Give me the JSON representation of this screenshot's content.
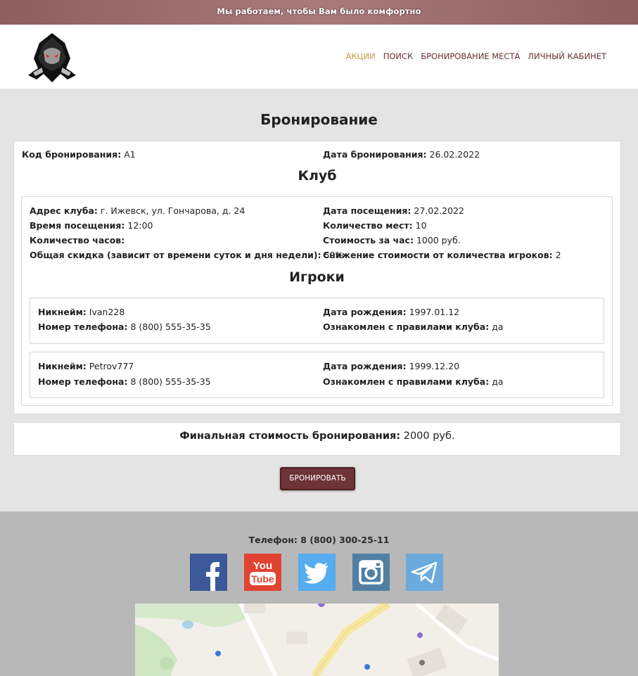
{
  "topbar": {
    "text": "Мы работаем, чтобы Вам было комфортно"
  },
  "nav": {
    "items": [
      {
        "label": "АКЦИИ",
        "active": true
      },
      {
        "label": "ПОИСК",
        "active": false
      },
      {
        "label": "БРОНИРОВАНИЕ МЕСТА",
        "active": false
      },
      {
        "label": "ЛИЧНЫЙ КАБИНЕТ",
        "active": false
      }
    ]
  },
  "page": {
    "title": "Бронирование"
  },
  "booking": {
    "code_label": "Код бронирования:",
    "code": "A1",
    "date_label": "Дата бронирования:",
    "date": "26.02.2022"
  },
  "club": {
    "title": "Клуб",
    "address_label": "Адрес клуба:",
    "address": "г. Ижевск, ул. Гончарова, д. 24",
    "visit_date_label": "Дата посещения:",
    "visit_date": "27.02.2022",
    "visit_time_label": "Время посещения:",
    "visit_time": "12:00",
    "seats_label": "Количество мест:",
    "seats": "10",
    "hours_label": "Количество часов:",
    "hours": "",
    "price_label": "Стоимость за час:",
    "price": "1000 руб.",
    "discount_label": "Общая скидка (зависит от времени суток и дня недели):",
    "discount": "50%",
    "reduction_label": "Снижение стоимости от количества игроков:",
    "reduction": "2"
  },
  "players": {
    "title": "Игроки",
    "nick_label": "Никнейм:",
    "phone_label": "Номер телефона:",
    "birth_label": "Дата рождения:",
    "rules_label": "Ознакомлен с правилами клуба:",
    "list": [
      {
        "nick": "Ivan228",
        "phone": "8 (800) 555-35-35",
        "birth": "1997.01.12",
        "rules": "да"
      },
      {
        "nick": "Petrov777",
        "phone": "8 (800) 555-35-35",
        "birth": "1999.12.20",
        "rules": "да"
      }
    ]
  },
  "total": {
    "label": "Финальная стоимость бронирования:",
    "value": "2000 руб."
  },
  "actions": {
    "book_label": "БРОНИРОВАТЬ"
  },
  "footer": {
    "phone": "Телефон: 8 (800) 300-25-11",
    "social": [
      "facebook-icon",
      "youtube-icon",
      "twitter-icon",
      "instagram-icon",
      "telegram-icon"
    ]
  },
  "colors": {
    "accent": "#6e3437",
    "nav": "#6b2e35",
    "nav_active": "#c79a42",
    "topbar": "#9b6f70"
  }
}
